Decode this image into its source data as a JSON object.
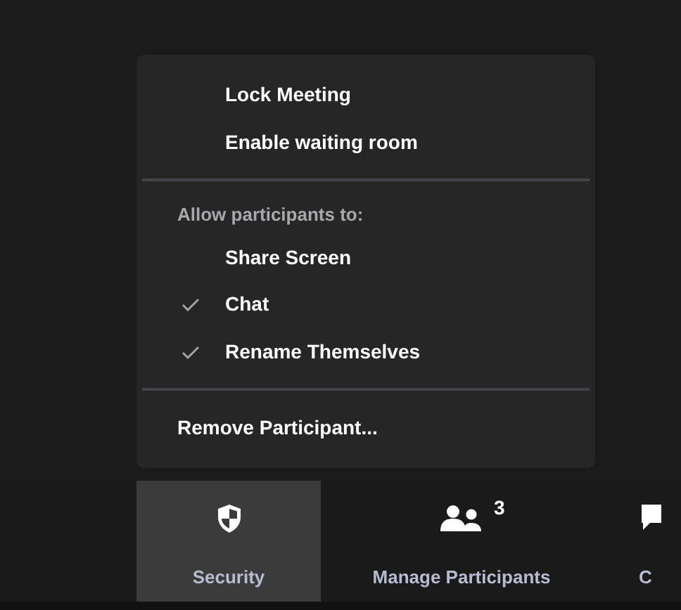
{
  "menu": {
    "groups": [
      {
        "items": [
          {
            "kind": "toggle",
            "label": "Lock Meeting",
            "checked": false
          },
          {
            "kind": "toggle",
            "label": "Enable waiting room",
            "checked": false
          }
        ]
      },
      {
        "header": "Allow participants to:",
        "items": [
          {
            "kind": "toggle",
            "label": "Share Screen",
            "checked": false
          },
          {
            "kind": "toggle",
            "label": "Chat",
            "checked": true
          },
          {
            "kind": "toggle",
            "label": "Rename Themselves",
            "checked": true
          }
        ]
      },
      {
        "items": [
          {
            "kind": "action",
            "label": "Remove Participant..."
          }
        ]
      }
    ]
  },
  "toolbar": {
    "buttons": [
      {
        "kind": "shield",
        "label": "Security",
        "selected": true
      },
      {
        "kind": "people",
        "label": "Manage Participants",
        "badge": "3",
        "selected": false
      },
      {
        "kind": "chat",
        "label": "C",
        "selected": false
      }
    ]
  }
}
